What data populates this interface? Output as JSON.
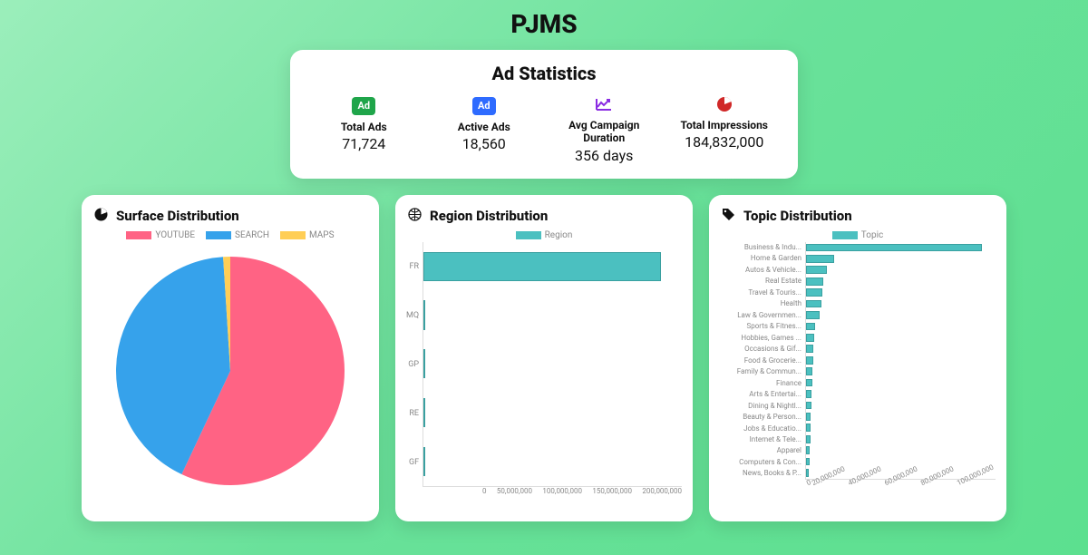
{
  "header": {
    "title": "PJMS"
  },
  "stats": {
    "title": "Ad Statistics",
    "items": [
      {
        "icon": "ad-green-icon",
        "label": "Total Ads",
        "value": "71,724"
      },
      {
        "icon": "ad-blue-icon",
        "label": "Active Ads",
        "value": "18,560"
      },
      {
        "icon": "trend-icon",
        "label": "Avg Campaign Duration",
        "value": "356 days"
      },
      {
        "icon": "pie-icon",
        "label": "Total Impressions",
        "value": "184,832,000"
      }
    ]
  },
  "surface": {
    "title": "Surface Distribution",
    "legend": {
      "youtube": "YOUTUBE",
      "search": "SEARCH",
      "maps": "MAPS"
    }
  },
  "region": {
    "title": "Region Distribution",
    "legend": "Region",
    "xticks": [
      "0",
      "50,000,000",
      "100,000,000",
      "150,000,000",
      "200,000,000"
    ]
  },
  "topic": {
    "title": "Topic Distribution",
    "legend": "Topic",
    "xticks": [
      "0",
      "20,000,000",
      "40,000,000",
      "60,000,000",
      "80,000,000",
      "100,000,000"
    ]
  },
  "chart_data": [
    {
      "type": "pie",
      "title": "Surface Distribution",
      "series": [
        {
          "name": "YOUTUBE",
          "value": 57,
          "color": "#ff6384"
        },
        {
          "name": "SEARCH",
          "value": 42,
          "color": "#36a2eb"
        },
        {
          "name": "MAPS",
          "value": 1,
          "color": "#ffce56"
        }
      ]
    },
    {
      "type": "bar",
      "orientation": "horizontal",
      "title": "Region Distribution",
      "xlabel": "",
      "ylabel": "",
      "xlim": [
        0,
        200000000
      ],
      "categories": [
        "FR",
        "MQ",
        "GP",
        "RE",
        "GF"
      ],
      "values": [
        184000000,
        1500000,
        1200000,
        1000000,
        500000
      ],
      "legend": "Region",
      "color": "#4bc0c0"
    },
    {
      "type": "bar",
      "orientation": "horizontal",
      "title": "Topic Distribution",
      "xlabel": "",
      "ylabel": "",
      "xlim": [
        0,
        100000000
      ],
      "categories": [
        "Business & Indu...",
        "Home & Garden",
        "Autos & Vehicle...",
        "Real Estate",
        "Travel & Touris...",
        "Health",
        "Law & Governmen...",
        "Sports & Fitnes...",
        "Hobbies, Games ...",
        "Occasions & Gif...",
        "Food & Grocerie...",
        "Family & Commun...",
        "Finance",
        "Arts & Entertai...",
        "Dining & Nightl...",
        "Beauty & Person...",
        "Jobs & Educatio...",
        "Internet & Tele...",
        "Apparel",
        "Computers & Con...",
        "News, Books & P..."
      ],
      "values": [
        93000000,
        15000000,
        11000000,
        9000000,
        8500000,
        8000000,
        7000000,
        5000000,
        4500000,
        4000000,
        3800000,
        3500000,
        3200000,
        3000000,
        2800000,
        2600000,
        2400000,
        2200000,
        2000000,
        1800000,
        1500000
      ],
      "legend": "Topic",
      "color": "#4bc0c0"
    }
  ]
}
